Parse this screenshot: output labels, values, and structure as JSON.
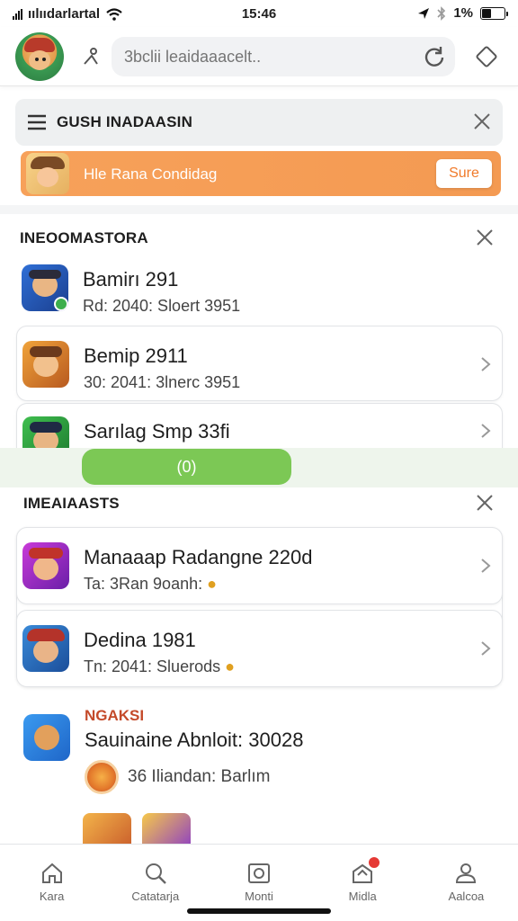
{
  "status_bar": {
    "carrier": "ıılııdarlartal",
    "time": "15:46",
    "battery": "1%",
    "battery_level": 0.1
  },
  "header": {
    "search_placeholder": "3bclii leaidaaacelt..",
    "icons": [
      "avatar",
      "person-icon",
      "refresh-icon",
      "diamond-icon"
    ]
  },
  "banner": {
    "title": "GUSH INADAASIN"
  },
  "promo": {
    "text": "Hle Rana Condidag",
    "button": "Sure"
  },
  "section1": {
    "title": "INEOOMASTORA",
    "items": [
      {
        "title": "Bamirı 291",
        "sub": "Rd: 2040: Sloert 3951"
      },
      {
        "title": "Bemip 2911",
        "sub": "30: 2041: 3lnerc 3951"
      },
      {
        "title": "Sarılag Smp 33fi",
        "sub": ""
      }
    ]
  },
  "toast": {
    "text": "(0)"
  },
  "section2": {
    "title": "IMEAIAASTS",
    "items": [
      {
        "title": "Manaaap Radangne 220d",
        "sub": "Ta: 3Ran 9oanh:"
      },
      {
        "title": "Dedina 1981",
        "sub": "Tn: 2041: Sluerods"
      }
    ]
  },
  "news": {
    "tag": "NGAKSI",
    "title": "Sauinaine Abnloit: 30028",
    "meta": "36  Iliandan: Barlım"
  },
  "tabs": [
    {
      "label": "Kara",
      "icon": "home-icon"
    },
    {
      "label": "Catatarja",
      "icon": "search-icon"
    },
    {
      "label": "Monti",
      "icon": "camera-icon"
    },
    {
      "label": "Midla",
      "icon": "inbox-icon"
    },
    {
      "label": "Aalcoa",
      "icon": "profile-icon"
    }
  ],
  "colors": {
    "accent_orange": "#f49a52",
    "green": "#7cc855",
    "badge_red": "#e53935"
  }
}
